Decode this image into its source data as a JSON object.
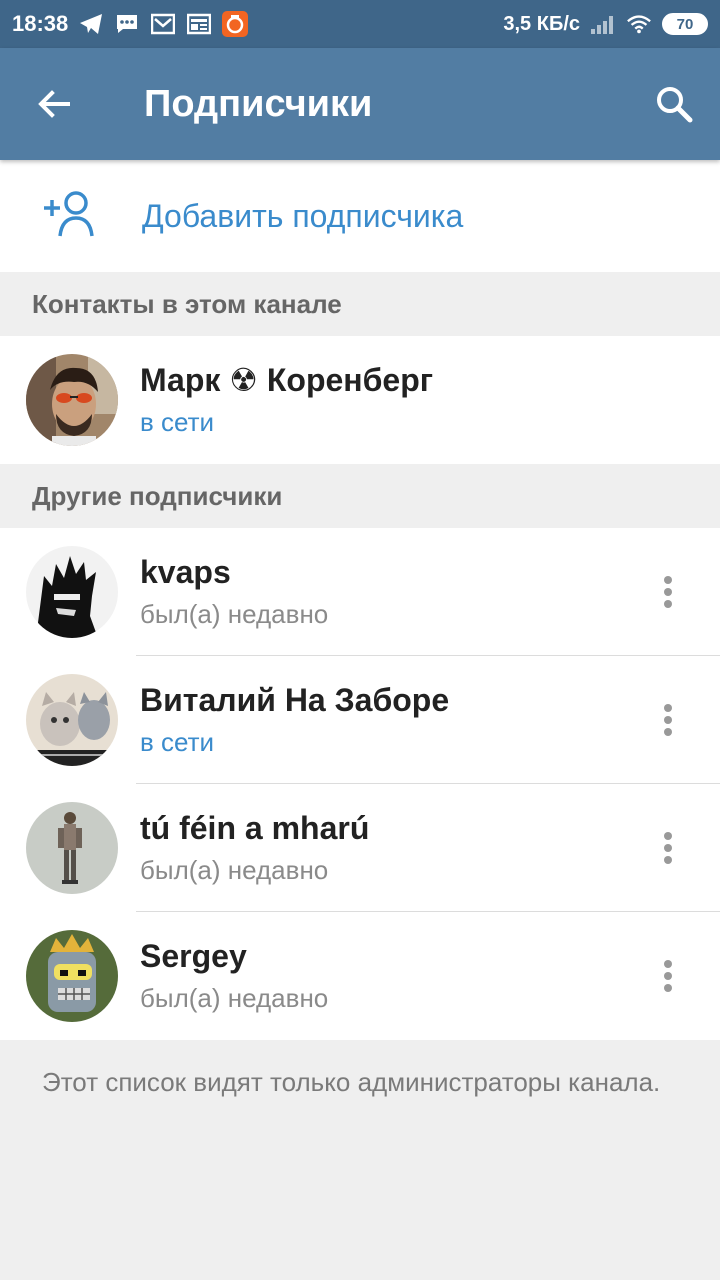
{
  "status_bar": {
    "time": "18:38",
    "speed": "3,5 КБ/с",
    "battery": "70",
    "icons": [
      "telegram-icon",
      "message-icon",
      "mail-icon",
      "news-icon",
      "app-notification-icon",
      "signal-icon",
      "wifi-icon",
      "battery-icon"
    ]
  },
  "app_bar": {
    "title": "Подписчики",
    "back_icon": "arrow-back-icon",
    "search_icon": "search-icon"
  },
  "add_subscriber": {
    "label": "Добавить подписчика",
    "icon": "add-user-icon"
  },
  "sections": {
    "contacts_header": "Контакты в этом канале",
    "others_header": "Другие подписчики"
  },
  "contacts": [
    {
      "name": "Марк ☢ Коренберг",
      "status": "в сети",
      "online": true
    }
  ],
  "subscribers": [
    {
      "name": "kvaps",
      "status": "был(а) недавно",
      "online": false
    },
    {
      "name": "Виталий На Заборе",
      "status": "в сети",
      "online": true
    },
    {
      "name": "tú féin a mharú",
      "status": "был(а) недавно",
      "online": false
    },
    {
      "name": "Sergey",
      "status": "был(а) недавно",
      "online": false
    }
  ],
  "footer": {
    "note": "Этот список видят только администраторы канала."
  },
  "colors": {
    "status_bar": "#3f6689",
    "app_bar": "#527da3",
    "accent": "#3a8bcc",
    "background": "#efefef"
  }
}
